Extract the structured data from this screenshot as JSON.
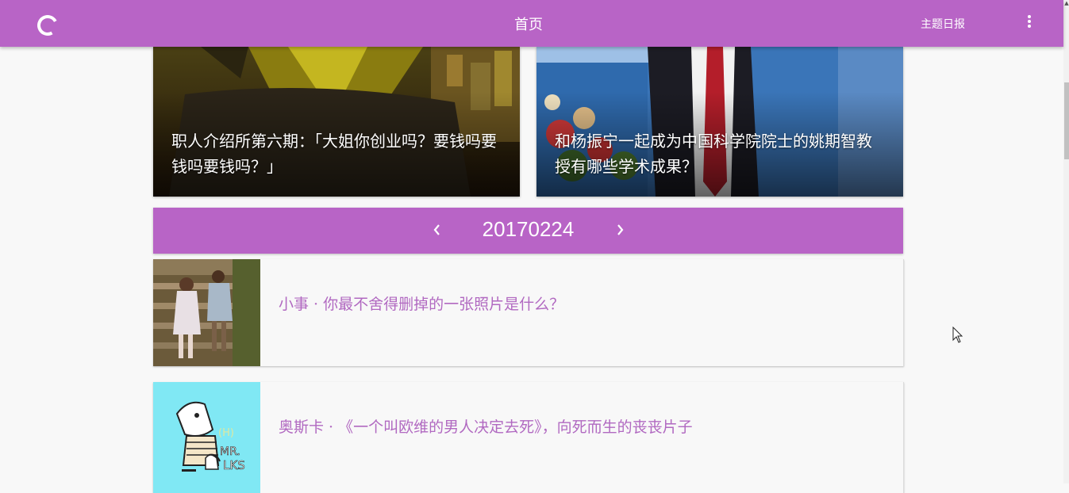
{
  "topbar": {
    "title": "首页",
    "topic_link": "主题日报",
    "loader_icon": "loading-spinner-icon",
    "more_icon": "more-vertical-icon",
    "color": "#b864c6"
  },
  "hero_cards": [
    {
      "caption": "职人介绍所第六期：「大姐你创业吗？要钱吗要钱吗要钱吗？」"
    },
    {
      "caption": "和杨振宁一起成为中国科学院院士的姚期智教授有哪些学术成果？"
    }
  ],
  "date_bar": {
    "date": "20170224",
    "prev_icon": "chevron-left-icon",
    "next_icon": "chevron-right-icon"
  },
  "news": [
    {
      "title": "小事 · 你最不舍得删掉的一张照片是什么？",
      "link_color": "#b169c1"
    },
    {
      "title": "奥斯卡 · 《一个叫欧维的男人决定去死》，向死而生的丧丧片子",
      "link_color": "#b169c1"
    }
  ]
}
